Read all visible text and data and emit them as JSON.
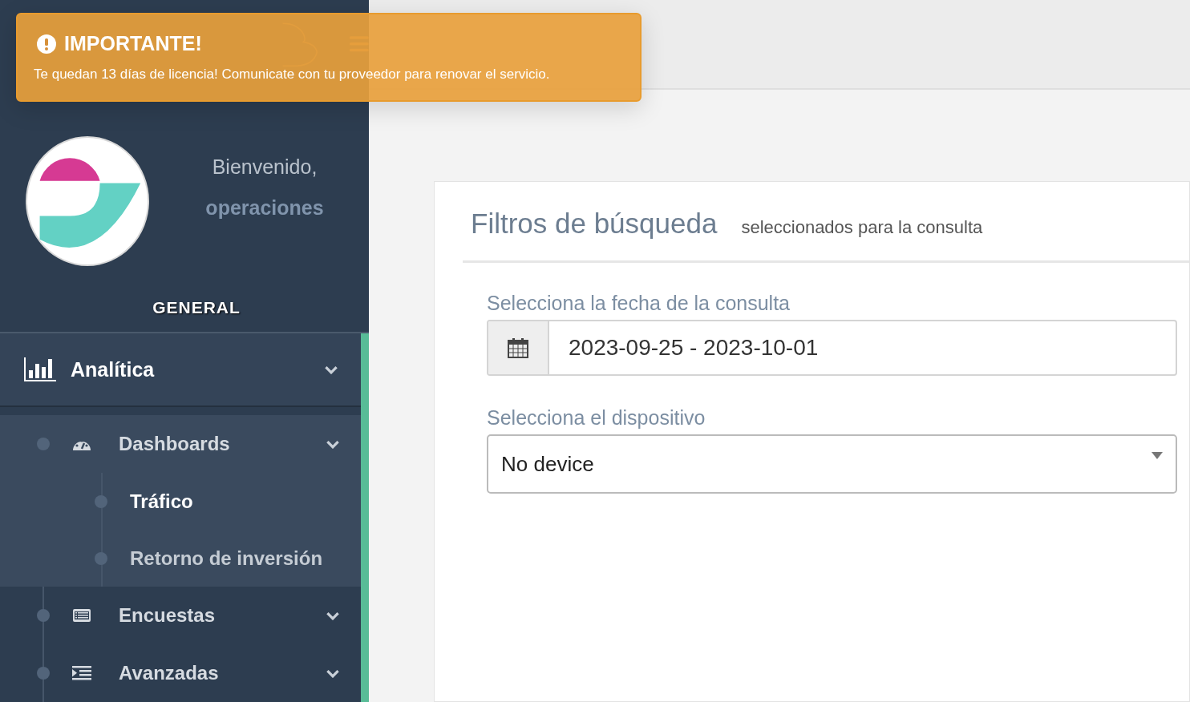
{
  "alert": {
    "title": "IMPORTANTE!",
    "message": "Te quedan 13 días de licencia! Comunicate con tu proveedor para renovar el servicio."
  },
  "profile": {
    "greeting": "Bienvenido,",
    "username": "operaciones"
  },
  "sidebar": {
    "section": "GENERAL",
    "menu": [
      {
        "label": "Analítica",
        "children": [
          {
            "label": "Dashboards",
            "children": [
              {
                "label": "Tráfico",
                "selected": true
              },
              {
                "label": "Retorno de inversión",
                "selected": false
              }
            ]
          },
          {
            "label": "Encuestas"
          },
          {
            "label": "Avanzadas"
          }
        ]
      }
    ]
  },
  "filters": {
    "title": "Filtros de búsqueda",
    "subtitle": "seleccionados para la consulta",
    "date_label": "Selecciona la fecha de la consulta",
    "date_value": "2023-09-25 - 2023-10-01",
    "device_label": "Selecciona el dispositivo",
    "device_value": "No device"
  }
}
